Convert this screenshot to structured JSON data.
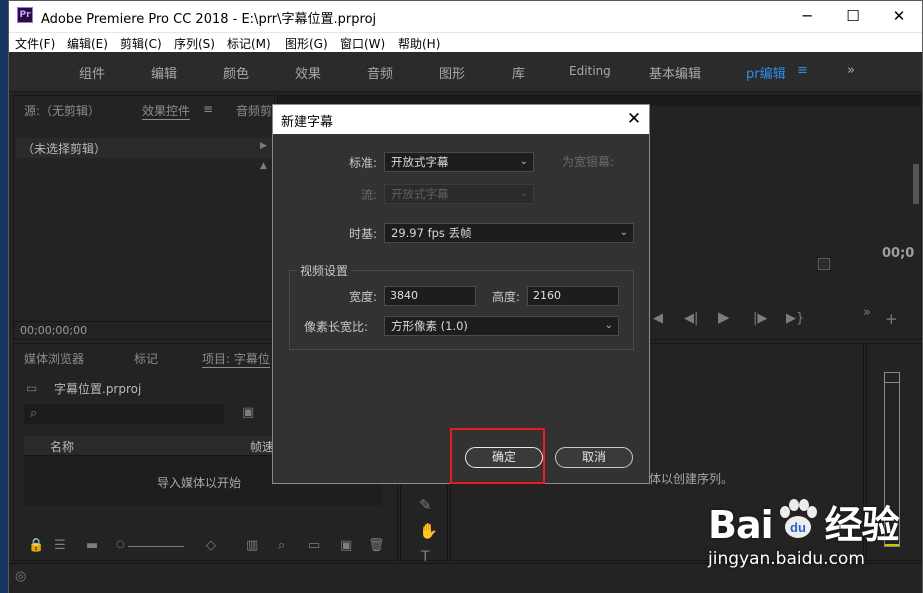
{
  "window": {
    "app_icon_text": "Pr",
    "title": "Adobe Premiere Pro CC 2018 - E:\\prr\\字幕位置.prproj",
    "minimize": "─",
    "maximize": "☐",
    "close": "✕"
  },
  "menu": [
    "文件(F)",
    "编辑(E)",
    "剪辑(C)",
    "序列(S)",
    "标记(M)",
    "图形(G)",
    "窗口(W)",
    "帮助(H)"
  ],
  "workspaces": {
    "items": [
      "组件",
      "编辑",
      "颜色",
      "效果",
      "音频",
      "图形",
      "库",
      "Editing",
      "基本编辑",
      "pr编辑"
    ],
    "active": "pr编辑",
    "menu_glyph": "≡",
    "overflow": "»"
  },
  "source_panel": {
    "tabs": [
      "源:（无剪辑）",
      "效果控件",
      "音频剪"
    ],
    "effect_menu": "≡",
    "no_clip": "（未选择剪辑）",
    "timecode": "00;00;00;00"
  },
  "program_panel": {
    "timecode": "00;0"
  },
  "project_panel": {
    "tabs": [
      "媒体浏览器",
      "标记",
      "项目: 字幕位"
    ],
    "project_file": "字幕位置.prproj",
    "columns": [
      "名称",
      "帧速"
    ],
    "empty_text": "导入媒体以开始"
  },
  "timeline_panel": {
    "hint": "体以创建序列。"
  },
  "dialog": {
    "title": "新建字幕",
    "close": "✕",
    "standard_label": "标准:",
    "standard_value": "开放式字幕",
    "deaf_label": "为宽银幕:",
    "stream_label": "流:",
    "stream_value": "开放式字幕",
    "timebase_label": "时基:",
    "timebase_value": "29.97 fps 丢帧",
    "video_group": "视频设置",
    "width_label": "宽度:",
    "width_value": "3840",
    "height_label": "高度:",
    "height_value": "2160",
    "par_label": "像素长宽比:",
    "par_value": "方形像素 (1.0)",
    "ok": "确定",
    "cancel": "取消"
  },
  "watermark": {
    "brand_left": "Bai",
    "brand_right": "经验",
    "url": "jingyan.baidu.com"
  },
  "colors": {
    "accent": "#2d8ceb",
    "highlight": "#e51c23",
    "panel_bg": "#232323",
    "dialog_bg": "#323232"
  }
}
